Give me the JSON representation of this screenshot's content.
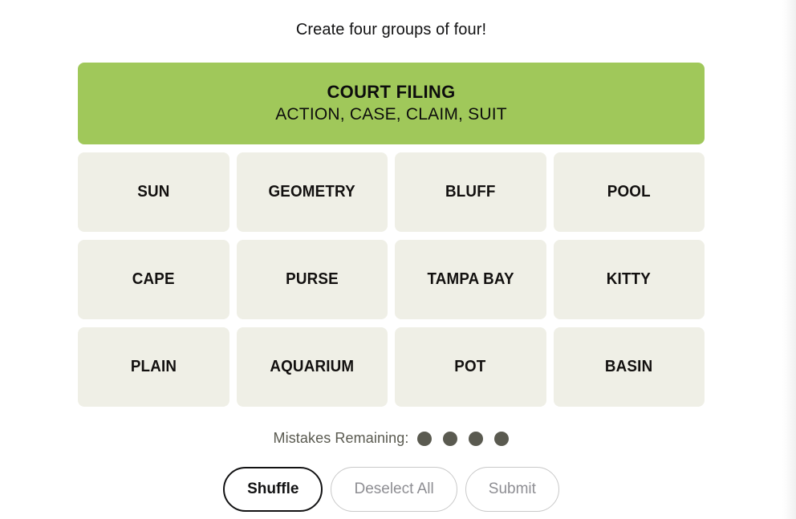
{
  "game": {
    "title": "Create four groups of four!"
  },
  "solved_groups": [
    {
      "name": "COURT FILING",
      "members": "ACTION, CASE, CLAIM, SUIT",
      "color": "#a0c85a"
    }
  ],
  "grid": {
    "rows": [
      [
        "SUN",
        "GEOMETRY",
        "BLUFF",
        "POOL"
      ],
      [
        "CAPE",
        "PURSE",
        "TAMPA BAY",
        "KITTY"
      ],
      [
        "PLAIN",
        "AQUARIUM",
        "POT",
        "BASIN"
      ]
    ],
    "tile_color": "#efefe6"
  },
  "mistakes": {
    "label": "Mistakes Remaining:",
    "remaining": 4,
    "dot_color": "#5a5a50"
  },
  "buttons": {
    "shuffle": "Shuffle",
    "deselect": "Deselect All",
    "submit": "Submit"
  }
}
